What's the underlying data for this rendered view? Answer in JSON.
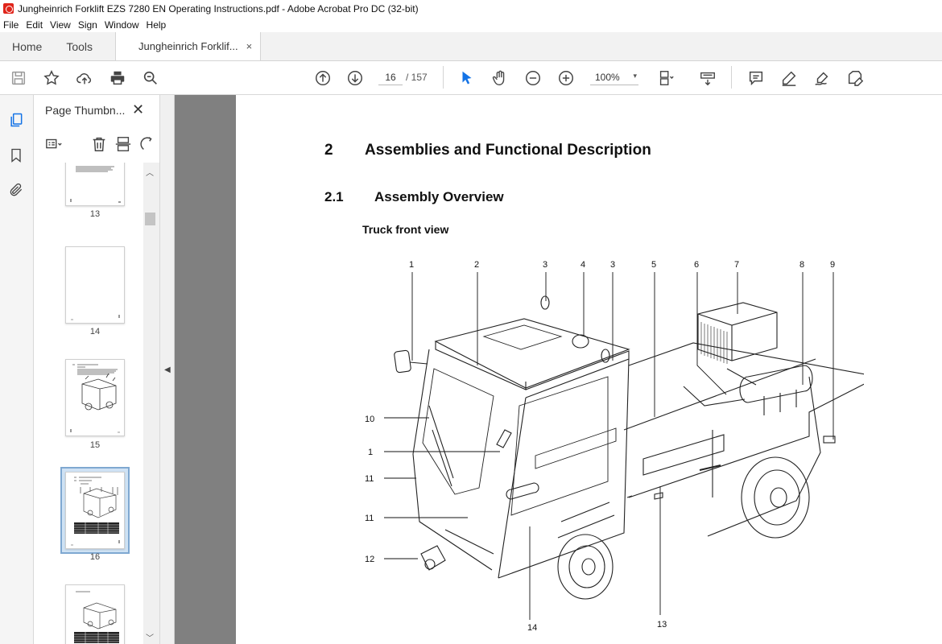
{
  "window": {
    "title": "Jungheinrich Forklift EZS 7280 EN Operating Instructions.pdf - Adobe Acrobat Pro DC (32-bit)"
  },
  "menu": [
    "File",
    "Edit",
    "View",
    "Sign",
    "Window",
    "Help"
  ],
  "tabs": {
    "home": "Home",
    "tools": "Tools",
    "document": "Jungheinrich Forklif...",
    "close_glyph": "×"
  },
  "toolbar": {
    "current_page": "16",
    "page_separator": "/ 157",
    "zoom": "100%",
    "zoom_dropdown": "▾"
  },
  "thumbnail_panel": {
    "title": "Page Thumbn...",
    "close_glyph": "✕",
    "pages": [
      {
        "label": "13",
        "selected": false
      },
      {
        "label": "14",
        "selected": false
      },
      {
        "label": "15",
        "selected": false
      },
      {
        "label": "16",
        "selected": true
      },
      {
        "label": "",
        "selected": false
      }
    ]
  },
  "document": {
    "chapter_number": "2",
    "chapter_title": "Assemblies and Functional Description",
    "section_number": "2.1",
    "section_title": "Assembly Overview",
    "subsection_title": "Truck front view",
    "figure_callouts": {
      "top": [
        "1",
        "2",
        "3",
        "4",
        "3",
        "5",
        "6",
        "7",
        "8",
        "9"
      ],
      "left": [
        "10",
        "1",
        "11",
        "11",
        "12"
      ],
      "bottom": [
        "14",
        "13"
      ]
    }
  },
  "colors": {
    "acrobat_red": "#e0251b",
    "accent_blue": "#1473e6",
    "canvas_gray": "#808080"
  }
}
